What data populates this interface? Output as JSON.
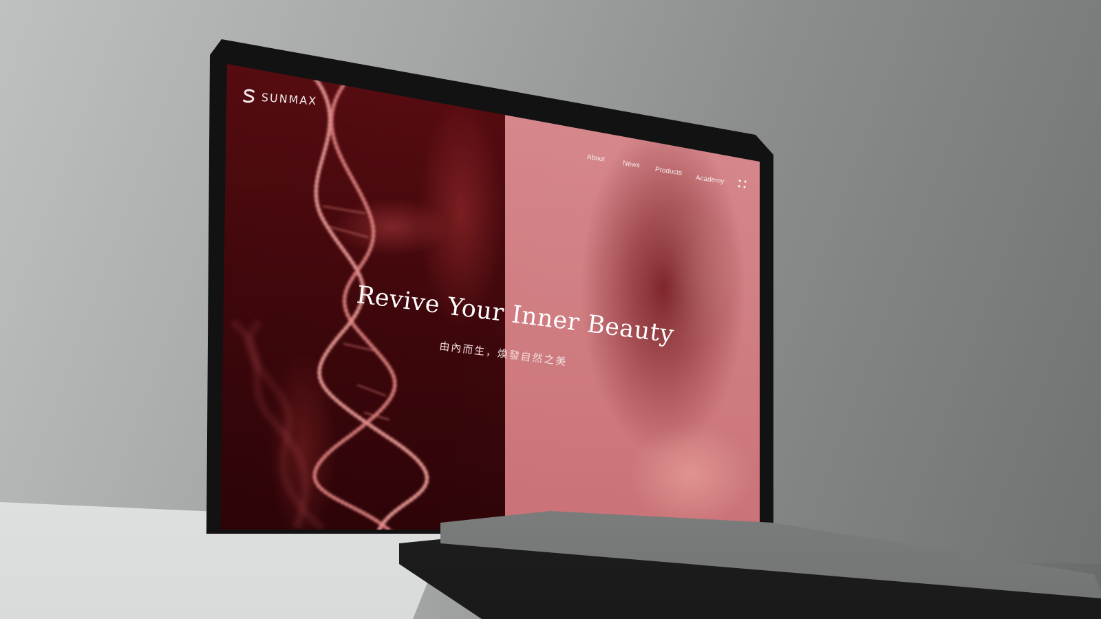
{
  "brand": {
    "logo_text": "SUNMAX",
    "logo_icon": "s-logo-icon"
  },
  "nav": {
    "items": [
      {
        "label": "About"
      },
      {
        "label": "News"
      },
      {
        "label": "Products"
      },
      {
        "label": "Academy"
      }
    ],
    "menu_icon": "grid-menu-icon"
  },
  "hero": {
    "headline": "Revive Your Inner Beauty",
    "subline": "由內而生，煥發自然之美"
  },
  "colors": {
    "left_panel": "#4a090e",
    "right_panel": "#d07b7f",
    "text": "#ffffff"
  }
}
